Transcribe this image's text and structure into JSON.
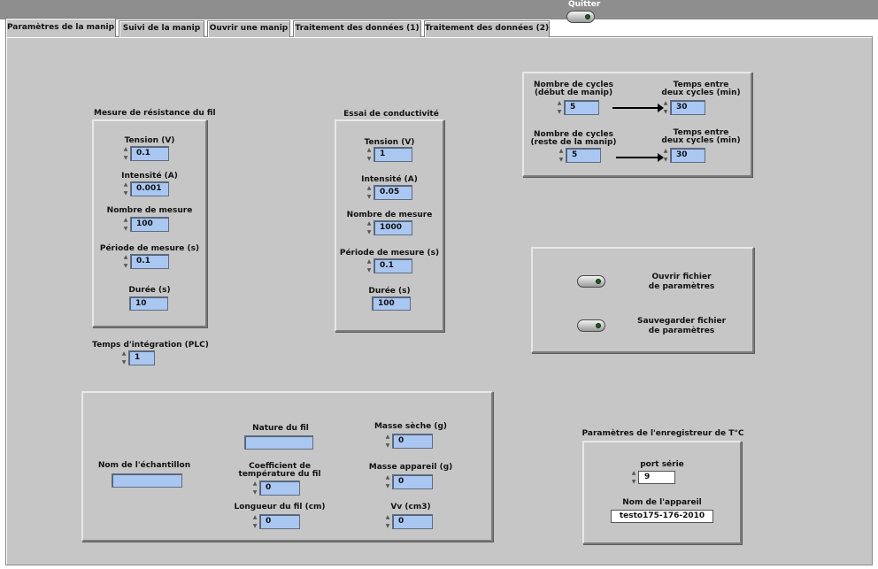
{
  "top": {
    "quit_label": "Quitter"
  },
  "tabs": [
    "Paramètres de la manip",
    "Suivi de la manip",
    "Ouvrir une manip",
    "Traitement des données (1)",
    "Traitement des données (2)"
  ],
  "resistance": {
    "title": "Mesure de résistance du fil",
    "tension_label": "Tension (V)",
    "tension": "0.1",
    "intensite_label": "Intensité (A)",
    "intensite": "0.001",
    "nb_mesure_label": "Nombre de mesure",
    "nb_mesure": "100",
    "periode_label": "Période de mesure (s)",
    "periode": "0.1",
    "duree_label": "Durée (s)",
    "duree": "10"
  },
  "integration": {
    "label": "Temps d'intégration (PLC)",
    "value": "1"
  },
  "conductivite": {
    "title": "Essai de conductivité",
    "tension_label": "Tension (V)",
    "tension": "1",
    "intensite_label": "Intensité (A)",
    "intensite": "0.05",
    "nb_mesure_label": "Nombre de mesure",
    "nb_mesure": "1000",
    "periode_label": "Période de mesure (s)",
    "periode": "0.1",
    "duree_label": "Durée (s)",
    "duree": "100"
  },
  "cycles": {
    "nb_debut_label_1": "Nombre de cycles",
    "nb_debut_label_2": "(début de manip)",
    "nb_debut": "5",
    "temps_debut_label_1": "Temps entre",
    "temps_debut_label_2": "deux cycles (min)",
    "temps_debut": "30",
    "nb_reste_label_1": "Nombre de cycles",
    "nb_reste_label_2": "(reste de la manip)",
    "nb_reste": "5",
    "temps_reste_label_1": "Temps entre",
    "temps_reste_label_2": "deux cycles (min)",
    "temps_reste": "30"
  },
  "fichiers": {
    "ouvrir_1": "Ouvrir fichier",
    "ouvrir_2": "de paramètres",
    "sauver_1": "Sauvegarder fichier",
    "sauver_2": "de paramètres"
  },
  "echantillon": {
    "nom_label": "Nom de l'échantillon",
    "nom": "",
    "nature_label": "Nature du fil",
    "nature": "",
    "coef_label_1": "Coefficient de",
    "coef_label_2": "température du fil",
    "coef": "0",
    "longueur_label": "Longueur du fil (cm)",
    "longueur": "0",
    "masse_seche_label": "Masse sèche (g)",
    "masse_seche": "0",
    "masse_app_label": "Masse appareil (g)",
    "masse_app": "0",
    "vv_label": "Vv (cm3)",
    "vv": "0"
  },
  "enregistreur": {
    "title": "Paramètres de l'enregistreur  de T°C",
    "port_label": "port série",
    "port": "9",
    "appareil_label": "Nom de l'appareil",
    "appareil": "testo175-176-2010"
  },
  "colors": {
    "panel": "#c6c6c6",
    "numeric": "#a9c7f1",
    "topbar": "#8e8e8e"
  }
}
